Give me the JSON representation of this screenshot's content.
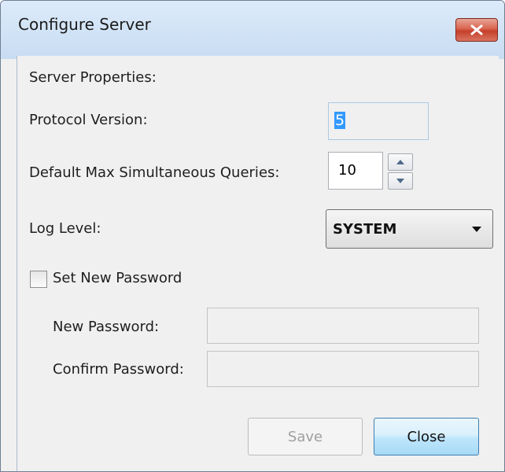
{
  "window": {
    "title": "Configure Server"
  },
  "icons": {
    "close": "close-x-icon",
    "spin_up": "triangle-up-icon",
    "spin_down": "triangle-down-icon",
    "dropdown": "chevron-down-icon"
  },
  "colors": {
    "title_close_button": "#c6402a",
    "selection": "#3399ff",
    "default_button_border": "#3c7fb1"
  },
  "form": {
    "section_label": "Server Properties:",
    "protocol_label": "Protocol Version:",
    "protocol_value": "5",
    "queries_label": "Default Max Simultaneous Queries:",
    "queries_value": "10",
    "log_level_label": "Log Level:",
    "log_level_value": "SYSTEM",
    "set_password_label": "Set New Password",
    "set_password_checked": false,
    "new_password_label": "New Password:",
    "new_password_value": "",
    "confirm_password_label": "Confirm Password:",
    "confirm_password_value": ""
  },
  "buttons": {
    "save": "Save",
    "close": "Close"
  }
}
